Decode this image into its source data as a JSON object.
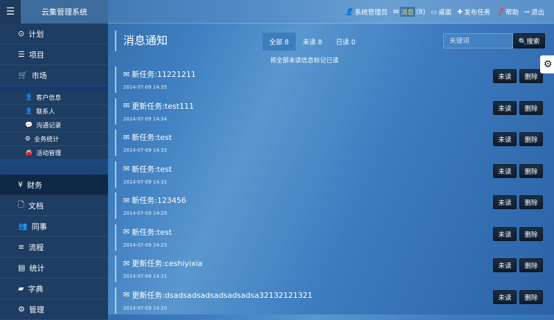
{
  "app": {
    "title": "云集管理系统"
  },
  "topnav": {
    "user": "系统管理员",
    "messages": "消息",
    "msg_count": "(8)",
    "desktop": "桌面",
    "publish": "发布任务",
    "help": "帮助",
    "logout": "退出"
  },
  "sidebar": {
    "items": [
      {
        "label": "计划",
        "icon": "clock"
      },
      {
        "label": "项目",
        "icon": "list"
      },
      {
        "label": "市场",
        "icon": "cart"
      }
    ],
    "sub": [
      {
        "label": "客户信息",
        "icon": "user"
      },
      {
        "label": "联系人",
        "icon": "user"
      },
      {
        "label": "沟通记录",
        "icon": "comments"
      },
      {
        "label": "业务统计",
        "icon": "cogs"
      },
      {
        "label": "活动管理",
        "icon": "car"
      }
    ],
    "items2": [
      {
        "label": "财务",
        "icon": "yen"
      },
      {
        "label": "文档",
        "icon": "file"
      },
      {
        "label": "同事",
        "icon": "group"
      },
      {
        "label": "流程",
        "icon": "tasks"
      },
      {
        "label": "统计",
        "icon": "chart"
      },
      {
        "label": "字典",
        "icon": "book"
      },
      {
        "label": "管理",
        "icon": "cog"
      }
    ]
  },
  "main": {
    "title": "消息通知",
    "tabs": [
      "全部 8",
      "未读 8",
      "已读 0"
    ],
    "mark_all": "将全部未读信息标记已读",
    "search_placeholder": "关键词",
    "search_button": "搜索",
    "messages": [
      {
        "title": "新任务:11221211",
        "date": "2014-07-09 14:35"
      },
      {
        "title": "更新任务:test111",
        "date": "2014-07-09 14:34"
      },
      {
        "title": "新任务:test",
        "date": "2014-07-09 14:33"
      },
      {
        "title": "新任务:test",
        "date": "2014-07-09 14:31"
      },
      {
        "title": "新任务:123456",
        "date": "2014-07-09 14:29"
      },
      {
        "title": "新任务:test",
        "date": "2014-07-09 14:23"
      },
      {
        "title": "更新任务:ceshiyixia",
        "date": "2014-07-09 14:21"
      },
      {
        "title": "更新任务:dsadsadsadsadsadsadsa32132121321",
        "date": "2014-07-09 14:20"
      }
    ],
    "unread_label": "未读",
    "delete_label": "删除"
  }
}
